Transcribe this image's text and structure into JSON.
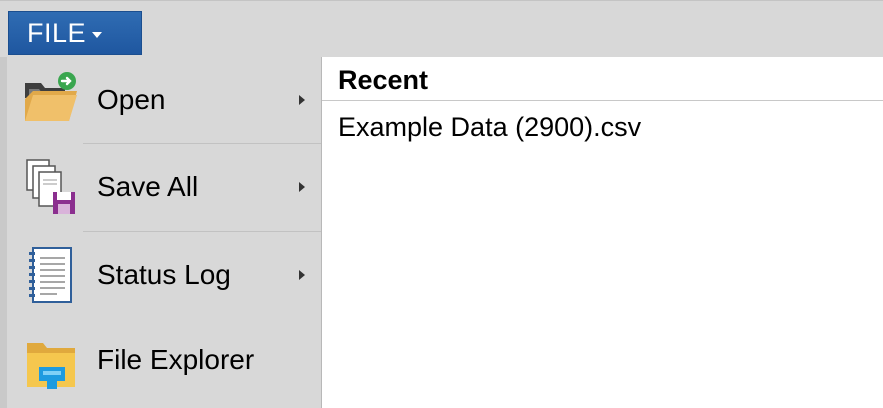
{
  "file_tab": {
    "label": "FILE",
    "icon": "chevron-down-icon",
    "color": "#2a64ad"
  },
  "menu": {
    "items": [
      {
        "label": "Open",
        "icon": "open-folder-icon",
        "has_submenu": true
      },
      {
        "label": "Save All",
        "icon": "save-all-icon",
        "has_submenu": true
      },
      {
        "label": "Status Log",
        "icon": "status-log-icon",
        "has_submenu": true
      },
      {
        "label": "File Explorer",
        "icon": "file-explorer-icon",
        "has_submenu": false
      }
    ]
  },
  "recent": {
    "heading": "Recent",
    "files": [
      "Example Data (2900).csv"
    ]
  }
}
